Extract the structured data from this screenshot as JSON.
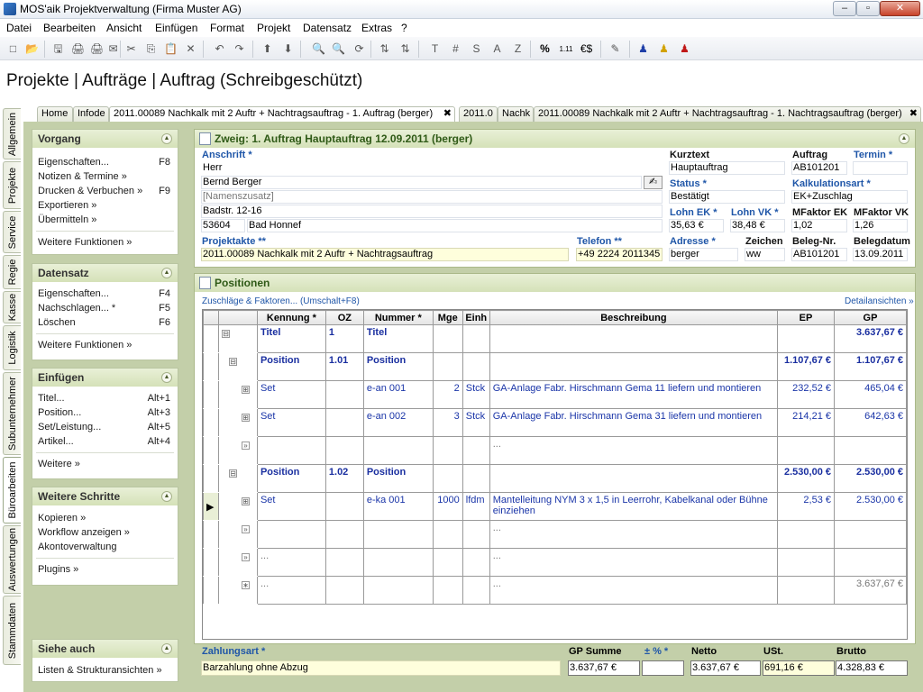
{
  "window": {
    "title": "MOS'aik Projektverwaltung (Firma Muster AG)",
    "minimize": "–",
    "maximize": "▫",
    "close": "✕"
  },
  "menu": [
    "Datei",
    "Bearbeiten",
    "Ansicht",
    "Einfügen",
    "Format",
    "Projekt",
    "Datensatz",
    "Extras",
    "?"
  ],
  "toolbar_glyphs": [
    "□",
    "📂",
    "🖫",
    "🖨",
    "🖨",
    "✉",
    "✂",
    "⎘",
    "📋",
    "✕",
    "↶",
    "↷",
    "⬆",
    "⬇",
    "🔍",
    "🔍",
    "⟳",
    "⇅",
    "⇅",
    "T",
    "#",
    "S",
    "A",
    "Z",
    "%",
    "1.11",
    "€$",
    "✎",
    "♟",
    "♟",
    "♟"
  ],
  "page_title": "Projekte | Aufträge | Auftrag (Schreibgeschützt)",
  "vtabs": [
    "Allgemein",
    "Projekte",
    "Service",
    "Regie",
    "Kasse",
    "Logistik",
    "Subunternehmer",
    "Büroarbeiten",
    "Auswertungen",
    "Stammdaten"
  ],
  "doctabs": [
    "Home",
    "Infode",
    "2011.00089 Nachkalk mit 2 Auftr + Nachtragsauftrag - 1. Auftrag (berger)",
    "2011.0",
    "Nachk",
    "2011.00089 Nachkalk mit 2 Auftr + Nachtragsauftrag - 1. Nachtragsauftrag (berger)"
  ],
  "doctab_close": "✖",
  "sidebar": {
    "vorgang": {
      "title": "Vorgang",
      "items": [
        {
          "label": "Eigenschaften...",
          "key": "F8"
        },
        {
          "label": "Notizen & Termine »",
          "key": ""
        },
        {
          "label": "Drucken & Verbuchen »",
          "key": "F9"
        },
        {
          "label": "Exportieren »",
          "key": ""
        },
        {
          "label": "Übermitteln »",
          "key": ""
        }
      ],
      "more": "Weitere Funktionen »"
    },
    "datensatz": {
      "title": "Datensatz",
      "items": [
        {
          "label": "Eigenschaften...",
          "key": "F4"
        },
        {
          "label": "Nachschlagen... *",
          "key": "F5"
        },
        {
          "label": "Löschen",
          "key": "F6"
        }
      ],
      "more": "Weitere Funktionen »"
    },
    "einfuegen": {
      "title": "Einfügen",
      "items": [
        {
          "label": "Titel...",
          "key": "Alt+1"
        },
        {
          "label": "Position...",
          "key": "Alt+3"
        },
        {
          "label": "Set/Leistung...",
          "key": "Alt+5"
        },
        {
          "label": "Artikel...",
          "key": "Alt+4"
        }
      ],
      "more": "Weitere »"
    },
    "schritte": {
      "title": "Weitere Schritte",
      "items": [
        {
          "label": "Kopieren »",
          "key": ""
        },
        {
          "label": "Workflow anzeigen »",
          "key": ""
        },
        {
          "label": "Akontoverwaltung",
          "key": ""
        }
      ],
      "more": "Plugins »"
    },
    "siehe": {
      "title": "Siehe auch",
      "items": [
        {
          "label": "Listen & Strukturansichten »",
          "key": ""
        }
      ]
    }
  },
  "header": {
    "title": "Zweig: 1. Auftrag Hauptauftrag 12.09.2011 (berger)",
    "anschrift_label": "Anschrift *",
    "anrede": "Herr",
    "name": "Bernd Berger",
    "zusatz": "[Namenszusatz]",
    "strasse": "Badstr. 12-16",
    "plz": "53604",
    "ort": "Bad Honnef",
    "projektakte_label": "Projektakte **",
    "projektakte": "2011.00089 Nachkalk mit 2 Auftr + Nachtragsauftrag",
    "telefon_label": "Telefon **",
    "telefon": "+49 2224 2011345",
    "kurztext_label": "Kurztext",
    "kurztext": "Hauptauftrag",
    "auftrag_label": "Auftrag",
    "auftrag": "AB101201",
    "termin_label": "Termin *",
    "termin": "",
    "status_label": "Status *",
    "status": "Bestätigt",
    "kalk_label": "Kalkulationsart *",
    "kalk": "EK+Zuschlag",
    "lohnek_label": "Lohn EK *",
    "lohnek": "35,63 €",
    "lohnvk_label": "Lohn VK *",
    "lohnvk": "38,48 €",
    "mfek_label": "MFaktor EK",
    "mfek": "1,02",
    "mfvk_label": "MFaktor VK",
    "mfvk": "1,26",
    "adresse_label": "Adresse *",
    "adresse": "berger",
    "zeichen_label": "Zeichen",
    "zeichen": "ww",
    "belegnr_label": "Beleg-Nr.",
    "belegnr": "AB101201",
    "belegdatum_label": "Belegdatum",
    "belegdatum": "13.09.2011"
  },
  "positions": {
    "title": "Positionen",
    "zuschlaege": "Zuschläge & Faktoren... (Umschalt+F8)",
    "details": "Detailansichten »",
    "columns": [
      "Kennung *",
      "OZ",
      "Nummer *",
      "Mge",
      "Einh",
      "Beschreibung",
      "EP",
      "GP"
    ],
    "rows": [
      {
        "type": "title",
        "tree": "⊟",
        "kennung": "Titel",
        "oz": "1",
        "nummer": "Titel",
        "mge": "",
        "einh": "",
        "beschreibung": "",
        "ep": "",
        "gp": "3.637,67 €"
      },
      {
        "type": "position",
        "tree": "⊟",
        "kennung": "Position",
        "oz": "1.01",
        "nummer": "Position",
        "mge": "",
        "einh": "",
        "beschreibung": "",
        "ep": "1.107,67 €",
        "gp": "1.107,67 €"
      },
      {
        "type": "set",
        "tree": "⊞",
        "kennung": "Set",
        "oz": "",
        "nummer": "e-an 001",
        "mge": "2",
        "einh": "Stck",
        "beschreibung": "GA-Anlage Fabr. Hirschmann Gema 11 liefern und montieren",
        "ep": "232,52 €",
        "gp": "465,04 €"
      },
      {
        "type": "set",
        "tree": "⊞",
        "kennung": "Set",
        "oz": "",
        "nummer": "e-an 002",
        "mge": "3",
        "einh": "Stck",
        "beschreibung": "GA-Anlage Fabr. Hirschmann Gema 31 liefern und montieren",
        "ep": "214,21 €",
        "gp": "642,63 €"
      },
      {
        "type": "empty",
        "tree": "»",
        "kennung": "",
        "oz": "",
        "nummer": "",
        "mge": "",
        "einh": "",
        "beschreibung": "...",
        "ep": "",
        "gp": ""
      },
      {
        "type": "position",
        "tree": "⊟",
        "kennung": "Position",
        "oz": "1.02",
        "nummer": "Position",
        "mge": "",
        "einh": "",
        "beschreibung": "",
        "ep": "2.530,00 €",
        "gp": "2.530,00 €"
      },
      {
        "type": "set",
        "tree": "⊞",
        "kennung": "Set",
        "oz": "",
        "nummer": "e-ka 001",
        "mge": "1000",
        "einh": "lfdm",
        "beschreibung": "Mantelleitung NYM 3 x 1,5 in Leerrohr, Kabelkanal oder Bühne einziehen",
        "ep": "2,53 €",
        "gp": "2.530,00 €"
      },
      {
        "type": "empty",
        "tree": "»",
        "kennung": "",
        "oz": "",
        "nummer": "",
        "mge": "",
        "einh": "",
        "beschreibung": "...",
        "ep": "",
        "gp": ""
      },
      {
        "type": "empty",
        "tree": "»",
        "kennung": "...",
        "oz": "",
        "nummer": "",
        "mge": "",
        "einh": "",
        "beschreibung": "...",
        "ep": "",
        "gp": ""
      },
      {
        "type": "sum",
        "tree": "∗",
        "kennung": "...",
        "oz": "",
        "nummer": "",
        "mge": "",
        "einh": "",
        "beschreibung": "...",
        "ep": "",
        "gp": "3.637,67 €"
      }
    ],
    "current_row_marker": "▶"
  },
  "footer": {
    "zahlungsart_label": "Zahlungsart *",
    "zahlungsart": "Barzahlung ohne Abzug",
    "gpsumme_label": "GP Summe",
    "gpsumme": "3.637,67 €",
    "pct_label": "± % *",
    "pct": "",
    "netto_label": "Netto",
    "netto": "3.637,67 €",
    "ust_label": "USt.",
    "ust": "691,16 €",
    "brutto_label": "Brutto",
    "brutto": "4.328,83 €"
  }
}
